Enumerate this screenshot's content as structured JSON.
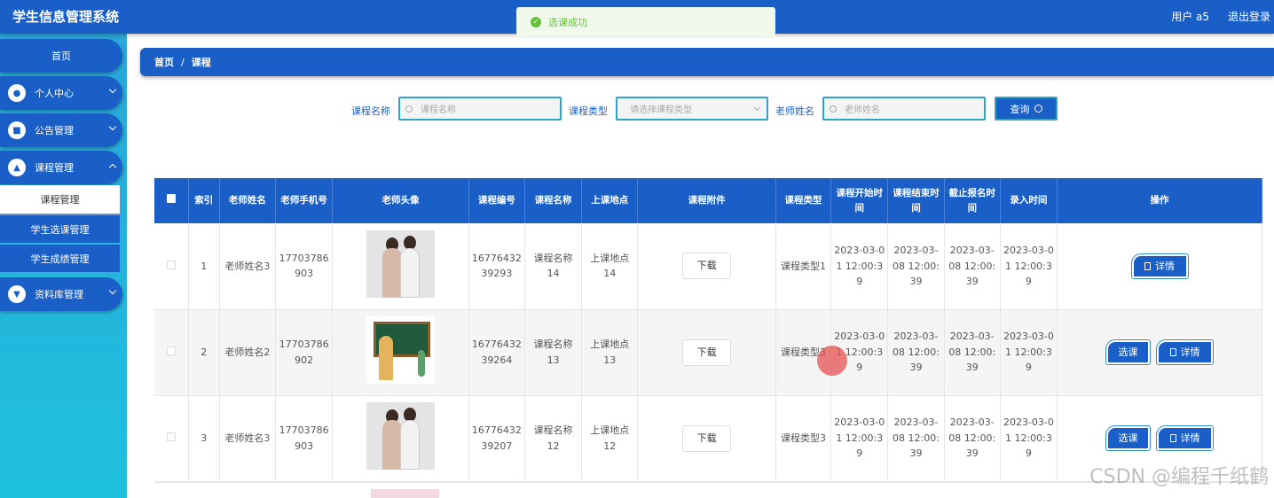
{
  "header": {
    "app_title": "学生信息管理系统",
    "user_label": "用户 a5",
    "logout_label": "退出登录"
  },
  "toast": {
    "message": "选课成功",
    "icon": "check-circle-icon"
  },
  "sidebar": {
    "home": "首页",
    "items": [
      {
        "label": "个人中心",
        "icon": "user-icon"
      },
      {
        "label": "公告管理",
        "icon": "notice-icon"
      },
      {
        "label": "课程管理",
        "icon": "course-icon"
      },
      {
        "label": "资料库管理",
        "icon": "library-icon"
      }
    ],
    "subitems": [
      {
        "label": "课程管理",
        "active": true
      },
      {
        "label": "学生选课管理",
        "active": false
      },
      {
        "label": "学生成绩管理",
        "active": false
      }
    ]
  },
  "breadcrumb": {
    "home": "首页",
    "separator": "/",
    "current": "课程"
  },
  "search": {
    "course_name_label": "课程名称",
    "course_name_placeholder": "课程名称",
    "course_type_label": "课程类型",
    "course_type_placeholder": "请选择课程类型",
    "teacher_name_label": "老师姓名",
    "teacher_name_placeholder": "老师姓名",
    "query_label": "查询"
  },
  "table": {
    "headers": [
      "索引",
      "老师姓名",
      "老师手机号",
      "老师头像",
      "课程编号",
      "课程名称",
      "上课地点",
      "课程附件",
      "课程类型",
      "课程开始时间",
      "课程结束时间",
      "截止报名时间",
      "录入时间",
      "操作"
    ],
    "download_label": "下载",
    "pick_label": "选课",
    "detail_label": "详情",
    "rows": [
      {
        "index": "1",
        "teacher": "老师姓名3",
        "phone": "17703786903",
        "avatar": "teachers-photo",
        "code": "1677643239293",
        "course": "课程名称14",
        "location": "上课地点14",
        "type": "课程类型1",
        "start": "2023-03-01 12:00:39",
        "end": "2023-03-08 12:00:39",
        "deadline": "2023-03-08 12:00:39",
        "entered": "2023-03-01 12:00:39",
        "can_pick": false
      },
      {
        "index": "2",
        "teacher": "老师姓名2",
        "phone": "17703786902",
        "avatar": "blackboard-illustration",
        "code": "1677643239264",
        "course": "课程名称13",
        "location": "上课地点13",
        "type": "课程类型3",
        "start": "2023-03-01 12:00:39",
        "end": "2023-03-08 12:00:39",
        "deadline": "2023-03-08 12:00:39",
        "entered": "2023-03-01 12:00:39",
        "can_pick": true
      },
      {
        "index": "3",
        "teacher": "老师姓名3",
        "phone": "17703786903",
        "avatar": "teachers-photo",
        "code": "1677643239207",
        "course": "课程名称12",
        "location": "上课地点12",
        "type": "课程类型3",
        "start": "2023-03-01 12:00:39",
        "end": "2023-03-08 12:00:39",
        "deadline": "2023-03-08 12:00:39",
        "entered": "2023-03-01 12:00:39",
        "can_pick": true
      }
    ]
  },
  "watermark": "CSDN @编程千纸鹤",
  "colors": {
    "primary": "#1a5fc8",
    "sidebar": "#1fc1df",
    "success": "#67c23a"
  }
}
